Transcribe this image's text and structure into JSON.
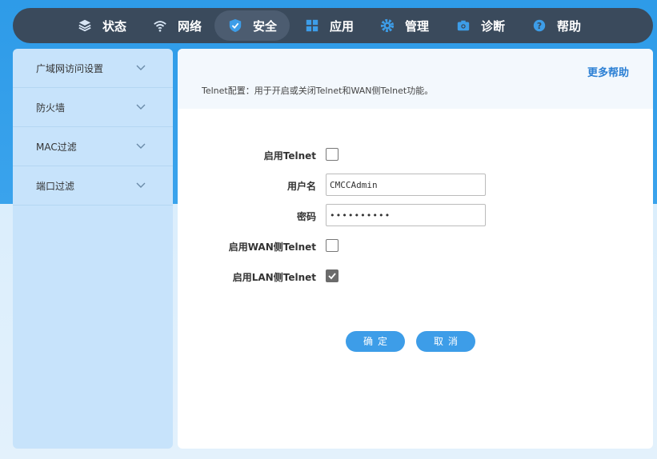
{
  "nav": {
    "items": [
      {
        "label": "状态",
        "icon": "layers-icon"
      },
      {
        "label": "网络",
        "icon": "wifi-icon"
      },
      {
        "label": "安全",
        "icon": "shield-icon"
      },
      {
        "label": "应用",
        "icon": "apps-grid-icon"
      },
      {
        "label": "管理",
        "icon": "gear-icon"
      },
      {
        "label": "诊断",
        "icon": "camera-icon"
      },
      {
        "label": "帮助",
        "icon": "help-icon"
      }
    ],
    "active": "安全"
  },
  "sidebar": {
    "items": [
      {
        "label": "广域网访问设置"
      },
      {
        "label": "防火墙"
      },
      {
        "label": "MAC过滤"
      },
      {
        "label": "端口过滤"
      }
    ]
  },
  "main": {
    "help_link": "更多帮助",
    "description": "Telnet配置：用于开启或关闭Telnet和WAN侧Telnet功能。",
    "form": {
      "enable_telnet_label": "启用Telnet",
      "enable_telnet": false,
      "username_label": "用户名",
      "username_value": "CMCCAdmin",
      "password_label": "密码",
      "password_value": "••••••••••",
      "enable_wan_telnet_label": "启用WAN侧Telnet",
      "enable_wan_telnet": false,
      "enable_lan_telnet_label": "启用LAN侧Telnet",
      "enable_lan_telnet": true
    },
    "buttons": {
      "confirm": "确定",
      "cancel": "取消"
    }
  },
  "colors": {
    "nav_bg": "#3a4a5c",
    "accent": "#3d9de8",
    "sidebar_bg": "#c7e3fb"
  }
}
